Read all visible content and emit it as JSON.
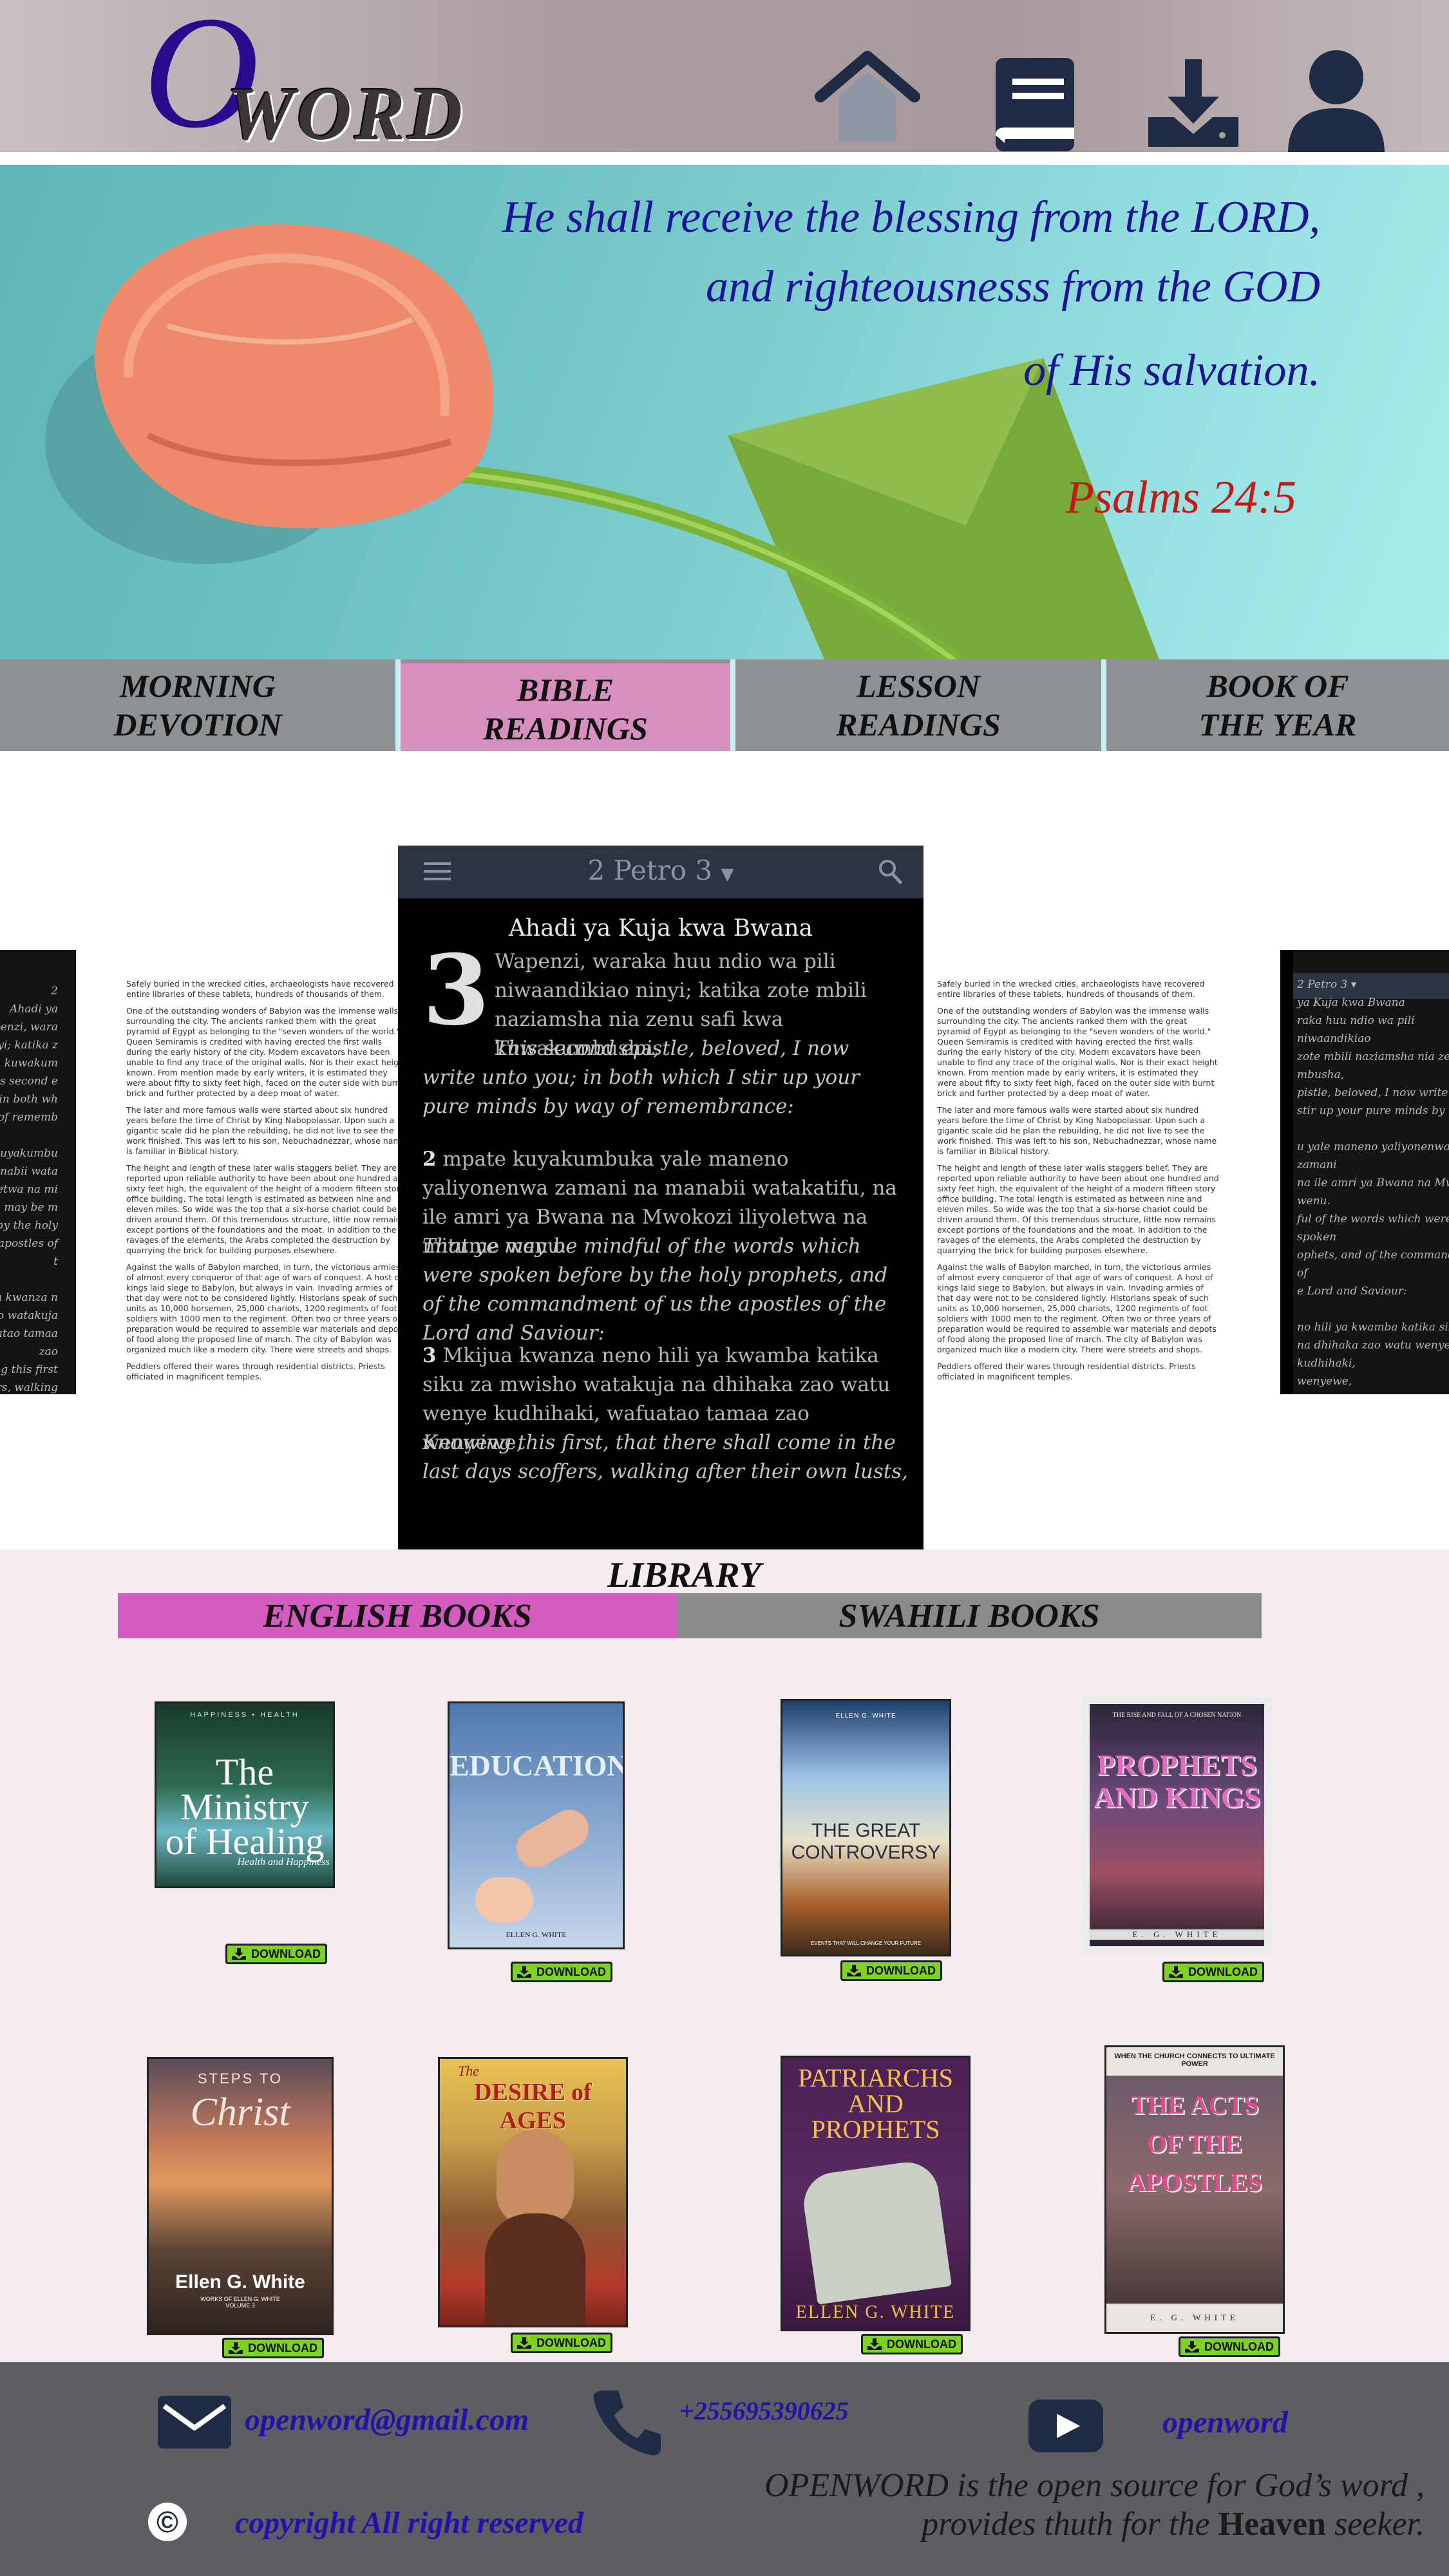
{
  "brand": {
    "logo_letter": "O",
    "logo_word": "WORD"
  },
  "nav": {
    "icons": [
      "home-icon",
      "book-icon",
      "download-icon",
      "user-icon"
    ],
    "icon_color": "#1f2a44"
  },
  "banner": {
    "verse_lines": [
      "He shall receive the blessing from the LORD,",
      "and righteousnesss from the GOD",
      "of His salvation."
    ],
    "reference": "Psalms 24:5"
  },
  "tabs": [
    {
      "label": "MORNING\nDEVOTION",
      "active": false
    },
    {
      "label": "BIBLE\nREADINGS",
      "active": true
    },
    {
      "label": "LESSON\nREADINGS",
      "active": false
    },
    {
      "label": "BOOK OF\nTHE YEAR",
      "active": false
    }
  ],
  "colors": {
    "active_tab": "#d68fbf",
    "tab_bg": "#8e9294",
    "english_tab": "#d35bbf",
    "swahili_tab": "#8a8a8a",
    "download_green": "#7ed321"
  },
  "reader": {
    "book_title": "2 Petro 3",
    "chapter_number": "3",
    "heading": "Ahadi ya Kuja kwa Bwana",
    "v1_sw": "Wapenzi, waraka huu ndio wa pili niwaandikiao ninyi; katika zote mbili naziamsha nia zenu safi kwa kuwakumbusha,",
    "v1_en": "This second epistle, beloved, I now write unto you; in both which I stir up your pure minds by way of remembrance:",
    "v2_num": "2",
    "v2_sw": "mpate kuyakumbuka yale maneno yaliyonenwa zamani na manabii watakatifu, na ile amri ya Bwana na Mwokozi iliyoletwa na mitume wenu.",
    "v2_en": "That ye may be mindful of the words which were spoken before by the holy prophets, and of the commandment of us the apostles of the Lord and Saviour:",
    "v3_num": "3",
    "v3_sw": "Mkijua kwanza neno hili ya kwamba katika siku za mwisho watakuja na dhihaka zao watu wenye kudhihaki, wafuatao tamaa zao wenyewe,",
    "v3_en": "Knowing this first, that there shall come in the last days scoffers, walking after their own lusts,"
  },
  "side_left_phone_text": "2\nAhadi ya\nWapenzi, wara\nninyi; katika z\nkwa kuwakum\nThis second e\nyou; in both wh\nway of rememb\n\nmpate kuyakumbu\nna manabii wata\niliyoletwa na mi\nThat ye may be m\nbefore by the holy\nus the apostles of t\n\nMkijua kwanza n\nmwisho watakuja\nwafuatao tamaa zao\nKnowing this first\nscoffers, walking aft",
  "side_right_phone_text": "2 Petro 3 ▾\nya Kuja kwa Bwana\nraka huu ndio wa pili niwaandikiao\nzote mbili naziamsha nia zenu safi\nmbusha,\npistle, beloved, I now write unto\nstir up your pure minds by\n\nu yale maneno yaliyonenwa zamani\nna ile amri ya Bwana na Mwokozi\nwenu.\nful of the words which were spoken\nophets, and of the commandment of\ne Lord and Saviour:\n\nno hili ya kwamba katika siku za\nna dhihaka zao watu wenye kudhihaki,\nwenyewe,\nat there shall come in the last days\nter their own lusts,",
  "side_doc_paragraphs": [
    "Safely buried in the wrecked cities, archaeologists have recovered entire libraries of these tablets, hundreds of thousands of them.",
    "One of the outstanding wonders of Babylon was the immense walls surrounding the city. The ancients ranked them with the great pyramid of Egypt as belonging to the \"seven wonders of the world.\" Queen Semiramis is credited with having erected the first walls during the early history of the city. Modern excavators have been unable to find any trace of the original walls. Nor is their exact height known. From mention made by early writers, it is estimated they were about fifty to sixty feet high, faced on the outer side with burnt brick and further protected by a deep moat of water.",
    "The later and more famous walls were started about six hundred years before the time of Christ by King Nabopolassar. Upon such a gigantic scale did he plan the rebuilding, he did not live to see the work finished. This was left to his son, Nebuchadnezzar, whose name is familiar in Biblical history.",
    "The height and length of these later walls staggers belief. They are reported upon reliable authority to have been about one hundred and sixty feet high, the equivalent of the height of a modern fifteen story office building. The total length is estimated as between nine and eleven miles. So wide was the top that a six-horse chariot could be driven around them. Of this tremendous structure, little now remains except portions of the foundations and the moat. In addition to the ravages of the elements, the Arabs completed the destruction by quarrying the brick for building purposes elsewhere.",
    "Against the walls of Babylon marched, in turn, the victorious armies of almost every conqueror of that age of wars of conquest. A host of kings laid siege to Babylon, but always in vain. Invading armies of that day were not to be considered lightly. Historians speak of such units as 10,000 horsemen, 25,000 chariots, 1200 regiments of foot soldiers with 1000 men to the regiment. Often two or three years of preparation would be required to assemble war materials and depots of food along the proposed line of march. The city of Babylon was organized much like a modern city. There were streets and shops.",
    "Peddlers offered their wares through residential districts. Priests officiated in magnificent temples."
  ],
  "library": {
    "title": "LIBRARY",
    "tabs": [
      "ENGLISH BOOKS",
      "SWAHILI BOOKS"
    ],
    "download_label": "DOWNLOAD",
    "books": [
      {
        "title": "The Ministry of Healing",
        "top": "HAPPINESS • HEALTH",
        "bottom": "Health and Happiness"
      },
      {
        "title": "EDUCATION",
        "top": "",
        "bottom": "ELLEN G. WHITE"
      },
      {
        "title": "THE GREAT CONTROVERSY",
        "top": "ELLEN G. WHITE",
        "bottom": "EVENTS THAT WILL CHANGE YOUR FUTURE"
      },
      {
        "title": "PROPHETS AND KINGS",
        "top": "THE RISE AND FALL OF A CHOSEN NATION",
        "bottom": "E. G. WHITE"
      },
      {
        "title": "Christ",
        "top": "STEPS TO",
        "bottom": "Ellen G. White",
        "sub": "WORKS OF ELLEN G. WHITE VOLUME 3"
      },
      {
        "title": "DESIRE of AGES",
        "top": "The",
        "bottom": ""
      },
      {
        "title": "PATRIARCHS AND PROPHETS",
        "top": "",
        "bottom": "ELLEN G. WHITE"
      },
      {
        "title": "THE ACTS OF THE APOSTLES",
        "top": "WHEN THE CHURCH CONNECTS TO ULTIMATE POWER",
        "bottom": "E. G. WHITE"
      }
    ]
  },
  "footer": {
    "email": "openword@gmail.com",
    "phone": "+255695390625",
    "youtube": "openword",
    "copyright_symbol": "©",
    "copyright_text": "copyright  All right reserved",
    "about_line1": "OPENWORD is the open source for God’s word ,",
    "about_line2_prefix": "provides thuth for the ",
    "about_line2_bold": "Heaven",
    "about_line2_suffix": " seeker."
  }
}
